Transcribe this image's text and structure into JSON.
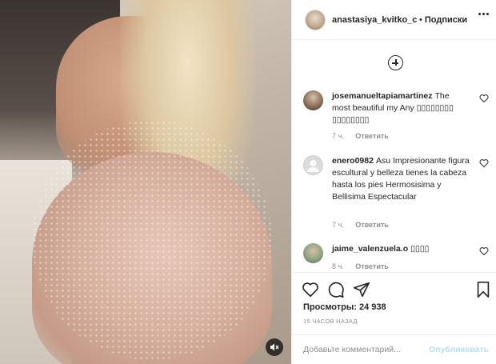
{
  "post": {
    "media_alt_icon": "mute-icon"
  },
  "header": {
    "username": "anastasiya_kvitko_clul",
    "separator": "•",
    "follow_label": "Подписки"
  },
  "comments": [
    {
      "user": "josemanueltapiamartinez",
      "text": "The most beautiful my Any ▯▯▯▯▯▯▯▯ ▯▯▯▯▯▯▯▯",
      "time": "7 ч.",
      "reply": "Ответить"
    },
    {
      "user": "enero0982",
      "text": "Asu Impresionante figura escultural y belleza tienes la cabeza hasta los pies Hermosisima y Bellisima Espectacular",
      "time": "7 ч.",
      "reply": "Ответить"
    },
    {
      "user": "jaime_valenzuela.o",
      "text": "▯▯▯▯",
      "time": "8 ч.",
      "reply": "Ответить"
    }
  ],
  "stats": {
    "views": "Просмотры: 24 938",
    "time_ago": "15 ЧАСОВ НАЗАД"
  },
  "composer": {
    "placeholder": "Добавьте комментарий...",
    "post_label": "Опубликовать"
  },
  "colors": {
    "post_button_disabled": "#b2dffc",
    "meta_gray": "#8e8e8e",
    "text": "#262626"
  }
}
